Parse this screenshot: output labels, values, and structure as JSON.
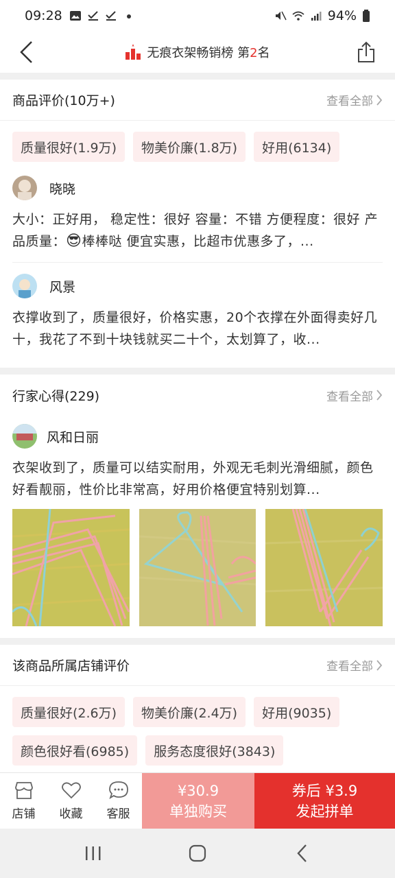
{
  "status": {
    "time": "09:28",
    "battery": "94%"
  },
  "header": {
    "rank_prefix": "无痕衣架畅销榜 第",
    "rank_num": "2",
    "rank_suffix": "名",
    "accent": "#e5332e"
  },
  "reviews": {
    "title": "商品评价(10万+)",
    "see_all": "查看全部",
    "tags": [
      "质量很好(1.9万)",
      "物美价廉(1.8万)",
      "好用(6134)"
    ],
    "items": [
      {
        "user": "晓晓",
        "text_a": "大小：正好用， 稳定性：很好 容量：不错 方便程度：很好 产品质量：",
        "emoji": "😎",
        "text_b": "棒棒哒 便宜实惠，比超市优惠多了，..."
      },
      {
        "user": "风景",
        "text": "衣撑收到了，质量很好，价格实惠，20个衣撑在外面得卖好几十，我花了不到十块钱就买二十个，太划算了，收..."
      }
    ]
  },
  "experts": {
    "title": "行家心得(229)",
    "see_all": "查看全部",
    "user": "风和日丽",
    "text": "衣架收到了，质量可以结实耐用，外观无毛刺光滑细腻，颜色好看靓丽，性价比非常高，好用价格便宜特别划算..."
  },
  "store": {
    "title": "该商品所属店铺评价",
    "see_all": "查看全部",
    "tags": [
      "质量很好(2.6万)",
      "物美价廉(2.4万)",
      "好用(9035)",
      "颜色很好看(6985)",
      "服务态度很好(3843)"
    ]
  },
  "bottom": {
    "shop": "店铺",
    "fav": "收藏",
    "service": "客服",
    "single_price": "¥30.9",
    "single_label": "单独购买",
    "group_price": "券后 ¥3.9",
    "group_label": "发起拼单"
  }
}
